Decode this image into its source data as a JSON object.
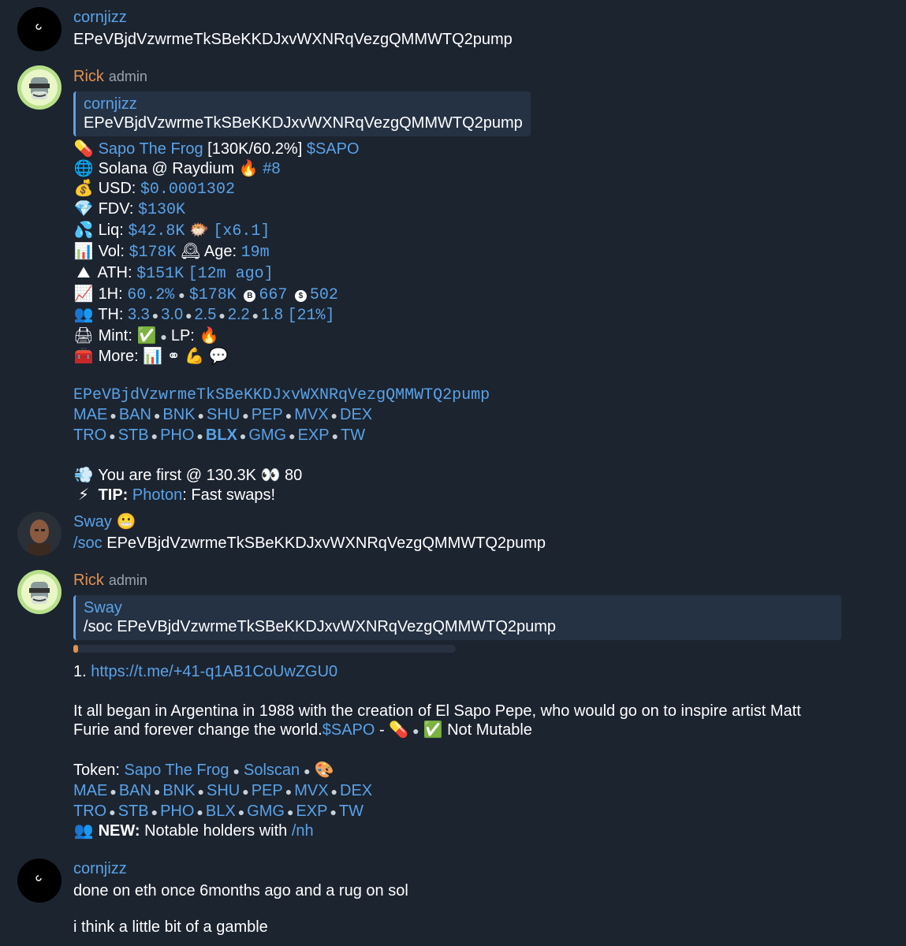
{
  "msg1": {
    "name": "cornjizz",
    "text": "EPeVBjdVzwrmeTkSBeKKDJxvWXNRqVezgQMMWTQ2pump"
  },
  "msg2": {
    "name": "Rick",
    "role": "admin",
    "quote_name": "cornjizz",
    "quote_text": "EPeVBjdVzwrmeTkSBeKKDJxvWXNRqVezgQMMWTQ2pump",
    "l1_token": "Sapo The Frog",
    "l1_mid": "[130K/60.2%]",
    "l1_ticker": "$SAPO",
    "l2_text": "Solana @ Raydium",
    "l2_rank": "#8",
    "l3_label": "USD:",
    "l3_val": "$0.0001302",
    "l4_label": "FDV:",
    "l4_val": "$130K",
    "l5_label": "Liq:",
    "l5_val": "$42.8K",
    "l5_mult": "[x6.1]",
    "l6_label": "Vol:",
    "l6_val": "$178K",
    "l6_age_label": "Age:",
    "l6_age": "19m",
    "l7_label": "ATH:",
    "l7_val": "$151K",
    "l7_ago": "[12m ago]",
    "l8_label": "1H:",
    "l8_pct": "60.2%",
    "l8_vol": "$178K",
    "l8_buy_icon": "B",
    "l8_buys": "667",
    "l8_sell_icon": "$",
    "l8_sells": "502",
    "l9_label": "TH:",
    "l9_values": [
      "3.3",
      "3.0",
      "2.5",
      "2.2",
      "1.8"
    ],
    "l9_total": "[21%]",
    "l10_mint": "Mint:",
    "l10_lp": "LP:",
    "l11_more": "More:",
    "address": "EPeVBjdVzwrmeTkSBeKKDJxvWXNRqVezgQMMWTQ2pump",
    "row1": [
      "MAE",
      "BAN",
      "BNK",
      "SHU",
      "PEP",
      "MVX",
      "DEX"
    ],
    "row2": [
      "TRO",
      "STB",
      "PHO",
      "BLX",
      "GMG",
      "EXP",
      "TW"
    ],
    "first_text": "You are first @ 130.3K",
    "first_views": "80",
    "tip_label": "TIP:",
    "tip_link": "Photon",
    "tip_text": ": Fast swaps!"
  },
  "msg3": {
    "name": "Sway",
    "command": "/soc",
    "text": "EPeVBjdVzwrmeTkSBeKKDJxvWXNRqVezgQMMWTQ2pump"
  },
  "msg4": {
    "name": "Rick",
    "role": "admin",
    "quote_name": "Sway",
    "quote_text": "/soc EPeVBjdVzwrmeTkSBeKKDJxvWXNRqVezgQMMWTQ2pump",
    "progress_fraction": 0.01,
    "link_num": "1.",
    "link": "https://t.me/+41-q1AB1CoUwZGU0",
    "desc_l1": "It all began in Argentina in 1988 with the creation of El Sapo Pepe, who would go on to inspire artist Matt",
    "desc_l2": "Furie and forever change the world.",
    "desc_ticker": "$SAPO",
    "desc_dash": " -",
    "desc_mutable": "Not Mutable",
    "token_label": "Token:",
    "token_name": "Sapo The Frog",
    "token_scan": "Solscan",
    "row1": [
      "MAE",
      "BAN",
      "BNK",
      "SHU",
      "PEP",
      "MVX",
      "DEX"
    ],
    "row2": [
      "TRO",
      "STB",
      "PHO",
      "BLX",
      "GMG",
      "EXP",
      "TW"
    ],
    "new_label": "NEW:",
    "new_text": " Notable holders with ",
    "new_cmd": "/nh"
  },
  "msg5": {
    "name": "cornjizz",
    "text1": "done on eth once 6months ago and a rug on sol",
    "text2": "i think a little bit of a gamble"
  },
  "icons": [
    "pill-icon",
    "globe-icon",
    "fire-icon",
    "money-bag-icon",
    "gem-icon",
    "droplets-icon",
    "pufferfish-icon",
    "bar-chart-icon",
    "clock-icon",
    "mountain-icon",
    "chart-up-icon",
    "people-icon",
    "printer-icon",
    "check-icon",
    "toolbox-icon",
    "eyes-icon",
    "lightning-icon",
    "dash-icon",
    "palette-icon",
    "muscle-icon",
    "speech-icon"
  ],
  "colors": {
    "background": "#1c2430",
    "link": "#5aa2e6",
    "admin_name": "#e2914d",
    "quote_bg": "#253244"
  }
}
